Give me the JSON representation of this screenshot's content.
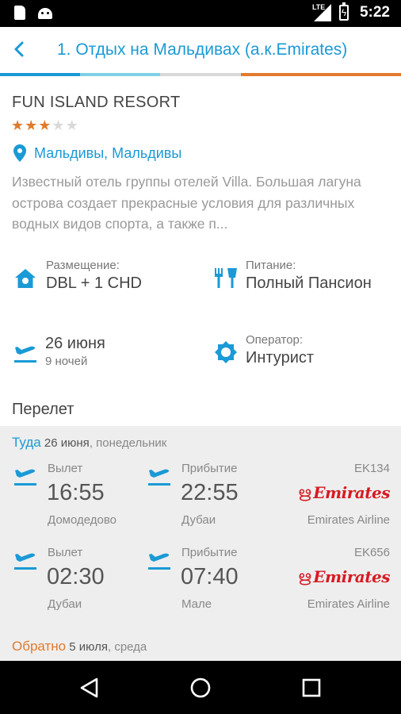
{
  "status_bar": {
    "time": "5:22",
    "network": "LTE",
    "icons": [
      "sd-card-icon",
      "android-icon",
      "signal-icon",
      "battery-charging-icon"
    ]
  },
  "header": {
    "title": "1. Отдых на Мальдивах (а.к.Emirates)",
    "back_icon": "chevron-left-icon",
    "bar_colors": [
      "#1a9ad6",
      "#7fd0e6",
      "#d8d8d8",
      "#e07b2c",
      "#e07b2c"
    ]
  },
  "hotel": {
    "name": "FUN ISLAND RESORT",
    "rating": 3,
    "rating_max": 5,
    "location": "Мальдивы, Мальдивы",
    "description": "Известный отель группы отелей Villa. Большая лагуна острова создает прекрасные условия для различных водных видов спорта, а также п..."
  },
  "details": {
    "accommodation": {
      "label": "Размещение:",
      "value": "DBL + 1 CHD",
      "icon": "home-icon"
    },
    "meals": {
      "label": "Питание:",
      "value": "Полный Пансион",
      "icon": "cutlery-icon"
    },
    "date": {
      "value": "26 июня",
      "sub": "9 ночей",
      "icon": "plane-takeoff-icon"
    },
    "operator": {
      "label": "Оператор:",
      "value": "Интурист",
      "icon": "gear-icon"
    }
  },
  "flights": {
    "heading": "Перелет",
    "outbound": {
      "direction": "Туда",
      "date": "26 июня",
      "weekday": ", понедельник",
      "legs": [
        {
          "dep_label": "Вылет",
          "dep_time": "16:55",
          "dep_place": "Домодедово",
          "arr_label": "Прибытие",
          "arr_time": "22:55",
          "arr_place": "Дубаи",
          "code": "EK134",
          "airline_logo": "Emirates",
          "airline": "Emirates Airline"
        },
        {
          "dep_label": "Вылет",
          "dep_time": "02:30",
          "dep_place": "Дубаи",
          "arr_label": "Прибытие",
          "arr_time": "07:40",
          "arr_place": "Мале",
          "code": "EK656",
          "airline_logo": "Emirates",
          "airline": "Emirates Airline"
        }
      ]
    },
    "return": {
      "direction": "Обратно",
      "date": "5 июля",
      "weekday": ", среда"
    }
  },
  "colors": {
    "accent": "#1a9ad6",
    "orange": "#e07b2c",
    "emirates_red": "#d71a21"
  },
  "nav_bar": {
    "buttons": [
      "back-triangle-icon",
      "home-circle-icon",
      "recents-square-icon"
    ]
  }
}
